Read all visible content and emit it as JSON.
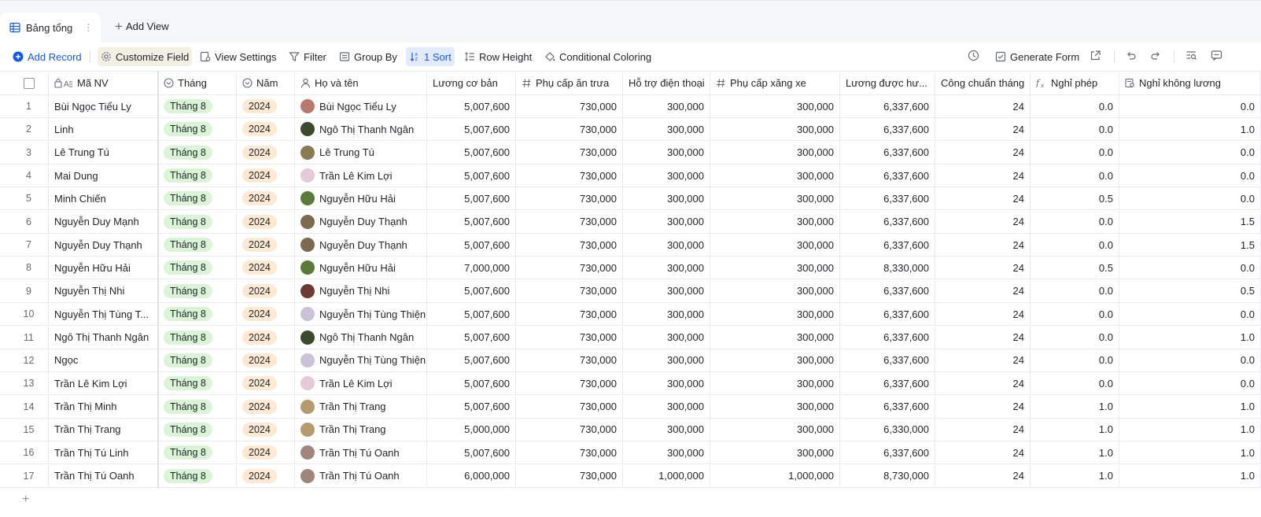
{
  "tabs": {
    "active_label": "Bảng tổng",
    "add_view_label": "Add View"
  },
  "toolbar": {
    "add_record": "Add Record",
    "customize_field": "Customize Field",
    "view_settings": "View Settings",
    "filter": "Filter",
    "group_by": "Group By",
    "sort": "1 Sort",
    "row_height": "Row Height",
    "conditional_coloring": "Conditional Coloring",
    "generate_form": "Generate Form"
  },
  "columns": [
    {
      "key": "ma_nv",
      "label": "Mã NV",
      "icon": "lock-text-icon"
    },
    {
      "key": "thang",
      "label": "Tháng",
      "icon": "single-select-icon"
    },
    {
      "key": "nam",
      "label": "Năm",
      "icon": "single-select-icon"
    },
    {
      "key": "ho_ten",
      "label": "Họ và tên",
      "icon": "person-icon"
    },
    {
      "key": "luong_co_ban",
      "label": "Lương cơ bản",
      "icon": ""
    },
    {
      "key": "phu_cap_an",
      "label": "Phụ cấp ăn trưa",
      "icon": "hash-icon"
    },
    {
      "key": "ho_tro_dt",
      "label": "Hỗ trợ điện thoại",
      "icon": ""
    },
    {
      "key": "phu_cap_xang",
      "label": "Phụ cấp xăng xe",
      "icon": "hash-icon"
    },
    {
      "key": "luong_duoc",
      "label": "Lương được hư...",
      "icon": ""
    },
    {
      "key": "cong_chuan",
      "label": "Công chuẩn tháng",
      "icon": ""
    },
    {
      "key": "nghi_phep",
      "label": "Nghỉ phép",
      "icon": "formula-icon"
    },
    {
      "key": "nghi_khong_luong",
      "label": "Nghỉ không lương",
      "icon": "lookup-icon"
    }
  ],
  "rows": [
    {
      "idx": "1",
      "ma_nv": "Bùi Ngọc Tiểu Ly",
      "thang": "Tháng 8",
      "nam": "2024",
      "ho_ten": "Bùi Ngọc Tiểu Ly",
      "avatar_color": "#b97a6b",
      "luong_co_ban": "5,007,600",
      "phu_cap_an": "730,000",
      "ho_tro_dt": "300,000",
      "phu_cap_xang": "300,000",
      "luong_duoc": "6,337,600",
      "cong_chuan": "24",
      "nghi_phep": "0.0",
      "nghi_khong_luong": "0.0"
    },
    {
      "idx": "2",
      "ma_nv": "Linh",
      "thang": "Tháng 8",
      "nam": "2024",
      "ho_ten": "Ngô Thị Thanh Ngân",
      "avatar_color": "#3c4a2e",
      "luong_co_ban": "5,007,600",
      "phu_cap_an": "730,000",
      "ho_tro_dt": "300,000",
      "phu_cap_xang": "300,000",
      "luong_duoc": "6,337,600",
      "cong_chuan": "24",
      "nghi_phep": "0.0",
      "nghi_khong_luong": "1.0"
    },
    {
      "idx": "3",
      "ma_nv": "Lê Trung Tú",
      "thang": "Tháng 8",
      "nam": "2024",
      "ho_ten": "Lê Trung Tú",
      "avatar_color": "#8a7b52",
      "luong_co_ban": "5,007,600",
      "phu_cap_an": "730,000",
      "ho_tro_dt": "300,000",
      "phu_cap_xang": "300,000",
      "luong_duoc": "6,337,600",
      "cong_chuan": "24",
      "nghi_phep": "0.0",
      "nghi_khong_luong": "0.0"
    },
    {
      "idx": "4",
      "ma_nv": "Mai Dung",
      "thang": "Tháng 8",
      "nam": "2024",
      "ho_ten": "Trần Lê Kim Lợi",
      "avatar_color": "#e6c9d6",
      "luong_co_ban": "5,007,600",
      "phu_cap_an": "730,000",
      "ho_tro_dt": "300,000",
      "phu_cap_xang": "300,000",
      "luong_duoc": "6,337,600",
      "cong_chuan": "24",
      "nghi_phep": "0.0",
      "nghi_khong_luong": "0.0"
    },
    {
      "idx": "5",
      "ma_nv": "Minh Chiến",
      "thang": "Tháng 8",
      "nam": "2024",
      "ho_ten": "Nguyễn Hữu Hải",
      "avatar_color": "#5a7a3a",
      "luong_co_ban": "5,007,600",
      "phu_cap_an": "730,000",
      "ho_tro_dt": "300,000",
      "phu_cap_xang": "300,000",
      "luong_duoc": "6,337,600",
      "cong_chuan": "24",
      "nghi_phep": "0.5",
      "nghi_khong_luong": "0.0"
    },
    {
      "idx": "6",
      "ma_nv": "Nguyễn Duy Mạnh",
      "thang": "Tháng 8",
      "nam": "2024",
      "ho_ten": "Nguyễn Duy Thạnh",
      "avatar_color": "#7b6a50",
      "luong_co_ban": "5,007,600",
      "phu_cap_an": "730,000",
      "ho_tro_dt": "300,000",
      "phu_cap_xang": "300,000",
      "luong_duoc": "6,337,600",
      "cong_chuan": "24",
      "nghi_phep": "0.0",
      "nghi_khong_luong": "1.5"
    },
    {
      "idx": "7",
      "ma_nv": "Nguyễn Duy Thạnh",
      "thang": "Tháng 8",
      "nam": "2024",
      "ho_ten": "Nguyễn Duy Thạnh",
      "avatar_color": "#7b6a50",
      "luong_co_ban": "5,007,600",
      "phu_cap_an": "730,000",
      "ho_tro_dt": "300,000",
      "phu_cap_xang": "300,000",
      "luong_duoc": "6,337,600",
      "cong_chuan": "24",
      "nghi_phep": "0.0",
      "nghi_khong_luong": "1.5"
    },
    {
      "idx": "8",
      "ma_nv": "Nguyễn Hữu Hải",
      "thang": "Tháng 8",
      "nam": "2024",
      "ho_ten": "Nguyễn Hữu Hải",
      "avatar_color": "#5a7a3a",
      "luong_co_ban": "7,000,000",
      "phu_cap_an": "730,000",
      "ho_tro_dt": "300,000",
      "phu_cap_xang": "300,000",
      "luong_duoc": "8,330,000",
      "cong_chuan": "24",
      "nghi_phep": "0.5",
      "nghi_khong_luong": "0.0"
    },
    {
      "idx": "9",
      "ma_nv": "Nguyễn Thị Nhi",
      "thang": "Tháng 8",
      "nam": "2024",
      "ho_ten": "Nguyễn Thị  Nhi",
      "avatar_color": "#6b3b32",
      "luong_co_ban": "5,007,600",
      "phu_cap_an": "730,000",
      "ho_tro_dt": "300,000",
      "phu_cap_xang": "300,000",
      "luong_duoc": "6,337,600",
      "cong_chuan": "24",
      "nghi_phep": "0.0",
      "nghi_khong_luong": "0.5"
    },
    {
      "idx": "10",
      "ma_nv": "Nguyễn Thị Tùng T...",
      "thang": "Tháng 8",
      "nam": "2024",
      "ho_ten": "Nguyễn Thị Tùng Thiện",
      "avatar_color": "#c9c2d8",
      "luong_co_ban": "5,007,600",
      "phu_cap_an": "730,000",
      "ho_tro_dt": "300,000",
      "phu_cap_xang": "300,000",
      "luong_duoc": "6,337,600",
      "cong_chuan": "24",
      "nghi_phep": "0.0",
      "nghi_khong_luong": "0.0"
    },
    {
      "idx": "11",
      "ma_nv": "Ngô Thị Thanh Ngân",
      "thang": "Tháng 8",
      "nam": "2024",
      "ho_ten": "Ngô Thị Thanh Ngân",
      "avatar_color": "#3c4a2e",
      "luong_co_ban": "5,007,600",
      "phu_cap_an": "730,000",
      "ho_tro_dt": "300,000",
      "phu_cap_xang": "300,000",
      "luong_duoc": "6,337,600",
      "cong_chuan": "24",
      "nghi_phep": "0.0",
      "nghi_khong_luong": "1.0"
    },
    {
      "idx": "12",
      "ma_nv": "Ngọc",
      "thang": "Tháng 8",
      "nam": "2024",
      "ho_ten": "Nguyễn Thị Tùng Thiện",
      "avatar_color": "#c9c2d8",
      "luong_co_ban": "5,007,600",
      "phu_cap_an": "730,000",
      "ho_tro_dt": "300,000",
      "phu_cap_xang": "300,000",
      "luong_duoc": "6,337,600",
      "cong_chuan": "24",
      "nghi_phep": "0.0",
      "nghi_khong_luong": "0.0"
    },
    {
      "idx": "13",
      "ma_nv": "Trần Lê Kim Lợi",
      "thang": "Tháng 8",
      "nam": "2024",
      "ho_ten": "Trần Lê Kim Lợi",
      "avatar_color": "#e6c9d6",
      "luong_co_ban": "5,007,600",
      "phu_cap_an": "730,000",
      "ho_tro_dt": "300,000",
      "phu_cap_xang": "300,000",
      "luong_duoc": "6,337,600",
      "cong_chuan": "24",
      "nghi_phep": "0.0",
      "nghi_khong_luong": "0.0"
    },
    {
      "idx": "14",
      "ma_nv": "Trần Thị Minh",
      "thang": "Tháng 8",
      "nam": "2024",
      "ho_ten": "Trần Thị Trang",
      "avatar_color": "#b59a6e",
      "luong_co_ban": "5,007,600",
      "phu_cap_an": "730,000",
      "ho_tro_dt": "300,000",
      "phu_cap_xang": "300,000",
      "luong_duoc": "6,337,600",
      "cong_chuan": "24",
      "nghi_phep": "1.0",
      "nghi_khong_luong": "1.0"
    },
    {
      "idx": "15",
      "ma_nv": "Trần Thị Trang",
      "thang": "Tháng 8",
      "nam": "2024",
      "ho_ten": "Trần Thị Trang",
      "avatar_color": "#b59a6e",
      "luong_co_ban": "5,000,000",
      "phu_cap_an": "730,000",
      "ho_tro_dt": "300,000",
      "phu_cap_xang": "300,000",
      "luong_duoc": "6,330,000",
      "cong_chuan": "24",
      "nghi_phep": "1.0",
      "nghi_khong_luong": "1.0"
    },
    {
      "idx": "16",
      "ma_nv": "Trần Thị Tú Linh",
      "thang": "Tháng 8",
      "nam": "2024",
      "ho_ten": "Trần Thị Tú Oanh",
      "avatar_color": "#a0857a",
      "luong_co_ban": "5,007,600",
      "phu_cap_an": "730,000",
      "ho_tro_dt": "300,000",
      "phu_cap_xang": "300,000",
      "luong_duoc": "6,337,600",
      "cong_chuan": "24",
      "nghi_phep": "1.0",
      "nghi_khong_luong": "1.0"
    },
    {
      "idx": "17",
      "ma_nv": "Trần Thị Tú Oanh",
      "thang": "Tháng 8",
      "nam": "2024",
      "ho_ten": "Trần Thị Tú Oanh",
      "avatar_color": "#a0857a",
      "luong_co_ban": "6,000,000",
      "phu_cap_an": "730,000",
      "ho_tro_dt": "1,000,000",
      "phu_cap_xang": "1,000,000",
      "luong_duoc": "8,730,000",
      "cong_chuan": "24",
      "nghi_phep": "1.0",
      "nghi_khong_luong": "1.0"
    }
  ],
  "colors": {
    "accent": "#1456f0",
    "month_pill": "#d9f5d6",
    "year_pill": "#feead2"
  }
}
